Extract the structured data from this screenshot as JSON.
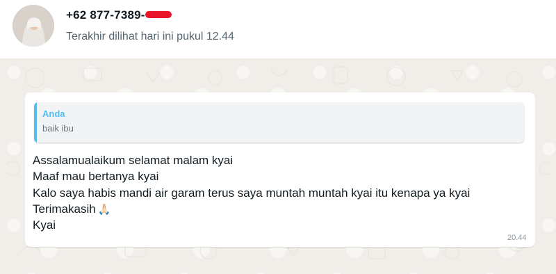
{
  "header": {
    "phone_visible": "+62 877-7389-",
    "last_seen": "Terakhir dilihat hari ini pukul 12.44"
  },
  "quote": {
    "author": "Anda",
    "text": "baik ibu"
  },
  "message": {
    "lines": [
      "Assalamualaikum selamat malam kyai",
      "Maaf mau bertanya  kyai",
      "Kalo saya habis mandi air garam terus saya muntah muntah kyai itu kenapa ya kyai",
      "Terimakasih",
      "Kyai"
    ],
    "emoji": "🙏🏻",
    "time": "20.44"
  },
  "colors": {
    "quote_accent": "#53bdeb",
    "redaction": "#e8142a",
    "chat_background": "#f1eee9"
  }
}
